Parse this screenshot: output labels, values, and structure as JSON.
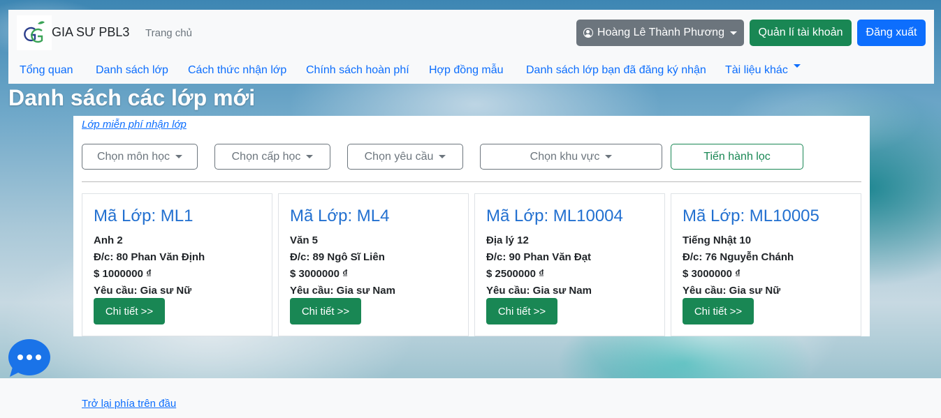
{
  "navbar": {
    "brand": "GIA SƯ PBL3",
    "home": "Trang chủ",
    "user_name": "Hoàng Lê Thành Phương",
    "account_button": "Quản lí tài khoản",
    "logout_button": "Đăng xuất",
    "menu": [
      "Tổng quan",
      "Danh sách lớp",
      "Cách thức nhận lớp",
      "Chính sách hoàn phí",
      "Hợp đồng mẫu",
      "Danh sách lớp bạn đã đăng ký nhận",
      "Tài liệu khác"
    ]
  },
  "page": {
    "title": "Danh sách các lớp mới",
    "free_link": "Lớp miễn phí nhận lớp",
    "back_to_top": "Trở lại phía trên đầu"
  },
  "filters": {
    "subject": "Chọn môn học",
    "level": "Chọn cấp học",
    "requirement": "Chọn yêu cầu",
    "area": "Chọn khu vực",
    "apply": "Tiến hành lọc"
  },
  "cards": [
    {
      "code": "Mã Lớp: ML1",
      "subject": "Anh 2",
      "address": "Đ/c: 80 Phan Văn Định",
      "price": "$ 1000000 ₫",
      "requirement": "Yêu cầu: Gia sư Nữ",
      "button": "Chi tiết >>"
    },
    {
      "code": "Mã Lớp: ML4",
      "subject": "Văn 5",
      "address": "Đ/c: 89 Ngô Sĩ Liên",
      "price": "$ 3000000 ₫",
      "requirement": "Yêu cầu: Gia sư Nam",
      "button": "Chi tiết >>"
    },
    {
      "code": "Mã Lớp: ML10004",
      "subject": "Địa lý 12",
      "address": "Đ/c: 90 Phan Văn Đạt",
      "price": "$ 2500000 ₫",
      "requirement": "Yêu cầu: Gia sư Nam",
      "button": "Chi tiết >>"
    },
    {
      "code": "Mã Lớp: ML10005",
      "subject": "Tiếng Nhật 10",
      "address": "Đ/c: 76 Nguyễn Chánh",
      "price": "$ 3000000 ₫",
      "requirement": "Yêu cầu: Gia sư Nữ",
      "button": "Chi tiết >>"
    }
  ],
  "icons": {
    "user": "user-circle-icon",
    "chat": "chat-bubble-icon",
    "logo": "gg-leaf-logo"
  },
  "colors": {
    "primary": "#0d6efd",
    "success": "#198754",
    "secondary": "#6c757d",
    "card_title": "#2270d0"
  }
}
